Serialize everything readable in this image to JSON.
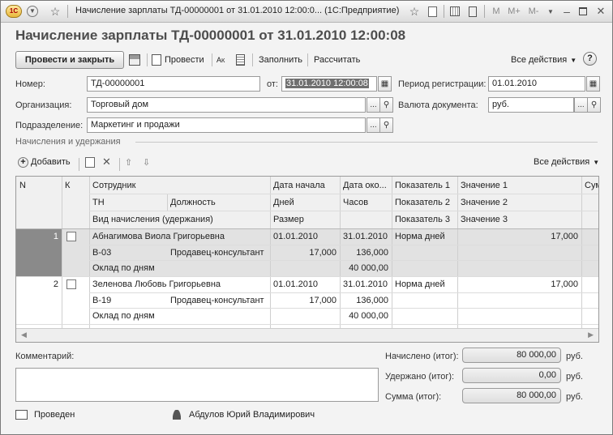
{
  "window": {
    "app_badge": "1С",
    "title": "Начисление зарплаты ТД-00000001 от 31.01.2010 12:00:0... (1С:Предприятие)",
    "right_tools": [
      "M",
      "M+",
      "M-"
    ]
  },
  "form": {
    "title": "Начисление зарплаты ТД-00000001 от 31.01.2010 12:00:08"
  },
  "toolbar": {
    "post_close": "Провести и закрыть",
    "post": "Провести",
    "fill": "Заполнить",
    "calculate": "Рассчитать",
    "all_actions": "Все действия",
    "help": "?"
  },
  "fields": {
    "number_label": "Номер:",
    "number_value": "ТД-00000001",
    "from_label": "от:",
    "date_value": "31.01.2010 12:00:08",
    "period_label": "Период регистрации:",
    "period_value": "01.01.2010",
    "org_label": "Организация:",
    "org_value": "Торговый дом",
    "currency_label": "Валюта документа:",
    "currency_value": "руб.",
    "dept_label": "Подразделение:",
    "dept_value": "Маркетинг и продажи",
    "ellipsis": "..."
  },
  "section": {
    "title": "Начисления и удержания"
  },
  "table_toolbar": {
    "add": "Добавить",
    "all_actions": "Все действия"
  },
  "table": {
    "headers": {
      "n": "N",
      "k": "К",
      "employee": "Сотрудник",
      "tn": "ТН",
      "position": "Должность",
      "accrual_type": "Вид начисления (удержания)",
      "date_start": "Дата начала",
      "days": "Дней",
      "size": "Размер",
      "date_end": "Дата око...",
      "hours": "Часов",
      "ind1": "Показатель 1",
      "ind2": "Показатель 2",
      "ind3": "Показатель 3",
      "val1": "Значение 1",
      "val2": "Значение 2",
      "val3": "Значение 3",
      "sum": "Сум"
    },
    "rows": [
      {
        "n": "1",
        "employee": "Абнагимова Виола Григорьевна",
        "tn": "В-03",
        "position": "Продавец-консультант",
        "accrual_type": "Оклад по дням",
        "date_start": "01.01.2010",
        "date_end": "31.01.2010",
        "days": "17,000",
        "hours": "136,000",
        "size": "40 000,00",
        "ind1": "Норма дней",
        "val1": "17,000"
      },
      {
        "n": "2",
        "employee": "Зеленова Любовь Григорьевна",
        "tn": "В-19",
        "position": "Продавец-консультант",
        "accrual_type": "Оклад по дням",
        "date_start": "01.01.2010",
        "date_end": "31.01.2010",
        "days": "17,000",
        "hours": "136,000",
        "size": "40 000,00",
        "ind1": "Норма дней",
        "val1": "17,000"
      }
    ]
  },
  "bottom": {
    "comment_label": "Комментарий:",
    "accrued_label": "Начислено (итог):",
    "accrued_value": "80 000,00",
    "withheld_label": "Удержано (итог):",
    "withheld_value": "0,00",
    "sum_label": "Сумма (итог):",
    "sum_value": "80 000,00",
    "currency": "руб."
  },
  "status": {
    "posted": "Проведен",
    "author": "Абдулов Юрий Владимирович"
  }
}
